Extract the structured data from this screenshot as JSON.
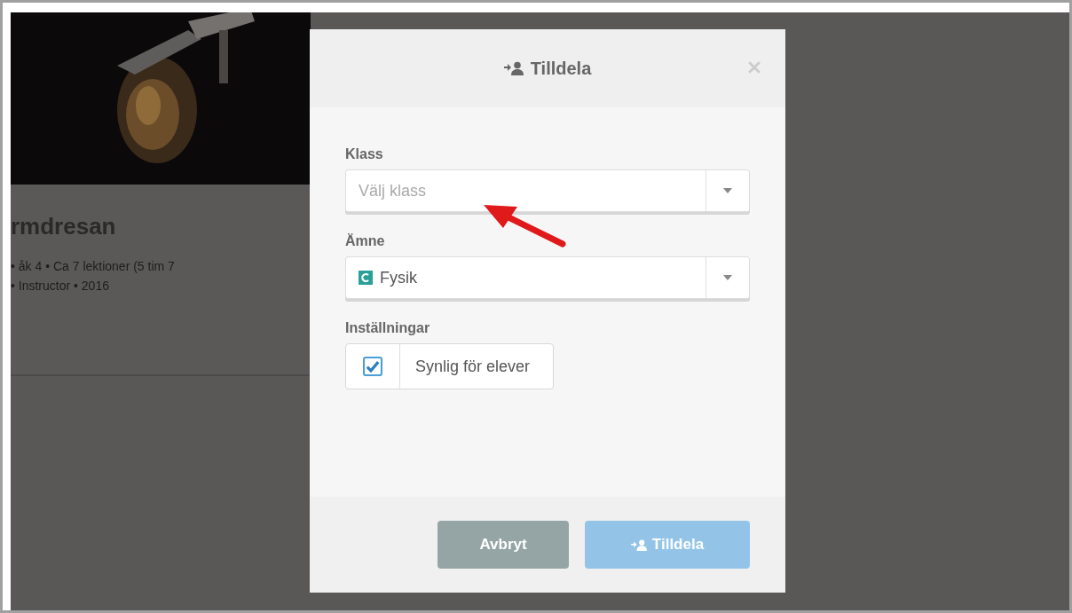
{
  "course_card": {
    "title": "rmdresan",
    "meta_lines": [
      "• åk 4 • Ca 7 lektioner (5 tim 7",
      "• Instructor • 2016"
    ]
  },
  "dialog": {
    "title": "Tilldela",
    "fields": [
      {
        "kind": "select",
        "label": "Klass",
        "placeholder": "Välj klass"
      },
      {
        "kind": "select",
        "label": "Ämne",
        "value": "Fysik",
        "subject_icon": true
      }
    ],
    "settings": {
      "label": "Inställningar",
      "options": [
        {
          "label": "Synlig för elever",
          "checked": true
        }
      ]
    },
    "buttons": [
      {
        "label": "Avbryt",
        "kind": "cancel"
      },
      {
        "label": "Tilldela",
        "kind": "primary",
        "disabled": true
      }
    ]
  }
}
